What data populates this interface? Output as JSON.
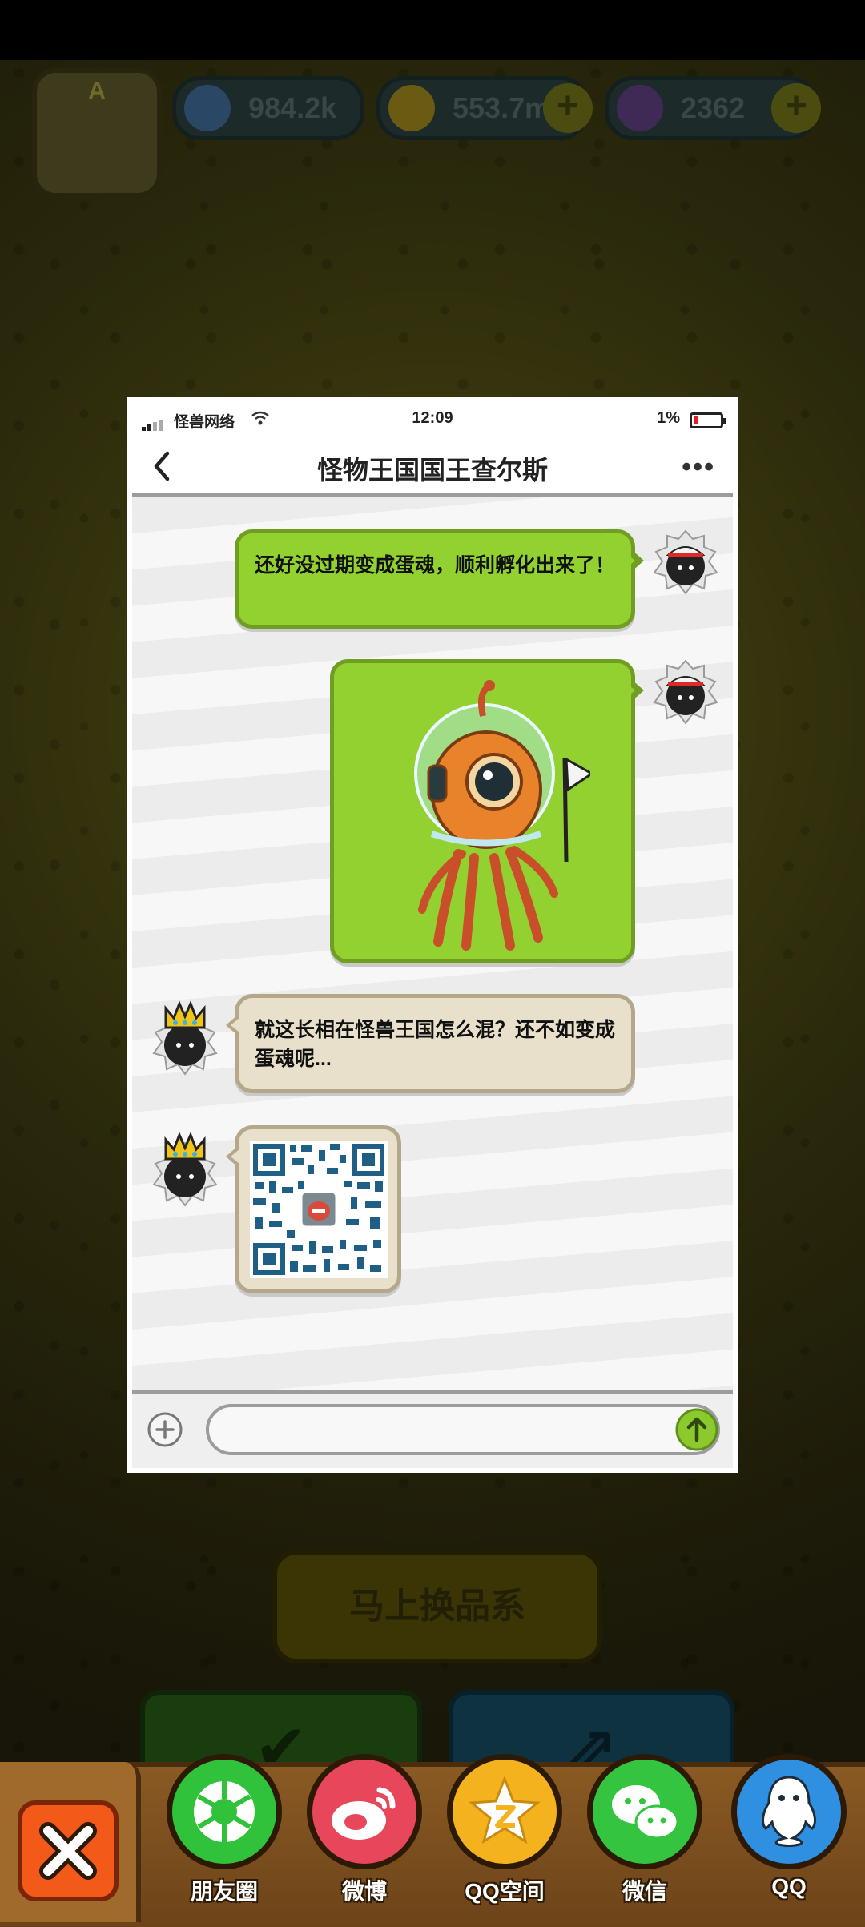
{
  "hud": {
    "rank_letter": "A",
    "eggs": "984.2k",
    "coins": "553.7m",
    "potions": "2362",
    "plus": "+"
  },
  "background": {
    "change_button": "马上换品系"
  },
  "phone": {
    "status": {
      "carrier": "怪兽网络",
      "time": "12:09",
      "battery": "1%"
    },
    "chat_title": "怪物王国国王查尔斯",
    "more": "•••",
    "messages": [
      {
        "sender": "self",
        "type": "text",
        "text": "还好没过期变成蛋魂，顺利孵化出来了！"
      },
      {
        "sender": "self",
        "type": "image",
        "image": "diving-helmet-octopus-monster"
      },
      {
        "sender": "king",
        "type": "text",
        "text": "就这长相在怪兽王国怎么混？还不如变成蛋魂呢..."
      },
      {
        "sender": "king",
        "type": "image",
        "image": "qr-code"
      }
    ],
    "input": {
      "placeholder": ""
    }
  },
  "share": {
    "items": [
      {
        "label": "朋友圈",
        "color": "#2fc23a",
        "icon": "moments-icon"
      },
      {
        "label": "微博",
        "color": "#e8465a",
        "icon": "weibo-icon"
      },
      {
        "label": "QQ空间",
        "color": "#f5b21f",
        "icon": "qzone-icon"
      },
      {
        "label": "微信",
        "color": "#34c43f",
        "icon": "wechat-icon"
      },
      {
        "label": "QQ",
        "color": "#2f8fe0",
        "icon": "qq-icon"
      }
    ]
  },
  "colors": {
    "bubble_green": "#92d130",
    "bubble_beige": "#e8e0cb",
    "close_button": "#f35a1a"
  }
}
